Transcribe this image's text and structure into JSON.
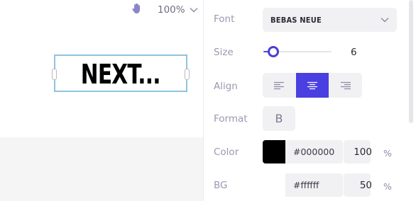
{
  "canvas": {
    "zoom_label": "100%",
    "text_content": "NEXT...",
    "icons": {
      "hand": "hand-icon",
      "zoom_chevron": "chevron-down-icon"
    }
  },
  "properties": {
    "font": {
      "label": "Font",
      "value": "BEBAS NEUE"
    },
    "size": {
      "label": "Size",
      "value": "6",
      "slider_fraction": 0.15
    },
    "align": {
      "label": "Align",
      "options": [
        "left",
        "center",
        "right"
      ],
      "selected": "center"
    },
    "format": {
      "label": "Format",
      "bold_label": "B"
    },
    "color": {
      "label": "Color",
      "swatch": "#000000",
      "hex": "#000000",
      "opacity": "100",
      "unit": "%"
    },
    "bg": {
      "label": "BG",
      "swatch": "#ffffff",
      "hex": "#ffffff",
      "opacity": "50",
      "unit": "%"
    }
  },
  "colors": {
    "accent": "#4a3fe0",
    "selection_border": "#8ec4de",
    "panel_field": "#f1f1f4"
  }
}
